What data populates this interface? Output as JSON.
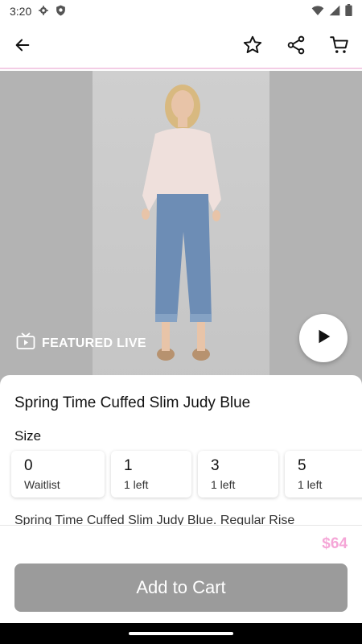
{
  "status_bar": {
    "time": "3:20",
    "icons": [
      "gear-icon",
      "shield-icon",
      "wifi-icon",
      "signal-icon",
      "battery-icon"
    ]
  },
  "app_bar": {
    "icons": [
      "back-arrow-icon",
      "star-icon",
      "share-icon",
      "cart-icon"
    ]
  },
  "hero": {
    "featured_label": "FEATURED LIVE",
    "featured_icon": "tv-icon",
    "play_icon": "play-icon"
  },
  "product": {
    "title": "Spring Time Cuffed Slim Judy Blue",
    "size_label": "Size",
    "sizes": [
      {
        "size": "0",
        "availability": "Waitlist"
      },
      {
        "size": "1",
        "availability": "1 left"
      },
      {
        "size": "3",
        "availability": "1 left"
      },
      {
        "size": "5",
        "availability": "1 left"
      }
    ],
    "description": "Spring Time Cuffed Slim Judy Blue. Regular Rise"
  },
  "footer": {
    "price": "$64",
    "add_to_cart_label": "Add to Cart"
  },
  "colors": {
    "accent_pink": "#f5a6d7",
    "button_gray": "#9b9b9b",
    "hero_background": "#b3b3b3"
  }
}
